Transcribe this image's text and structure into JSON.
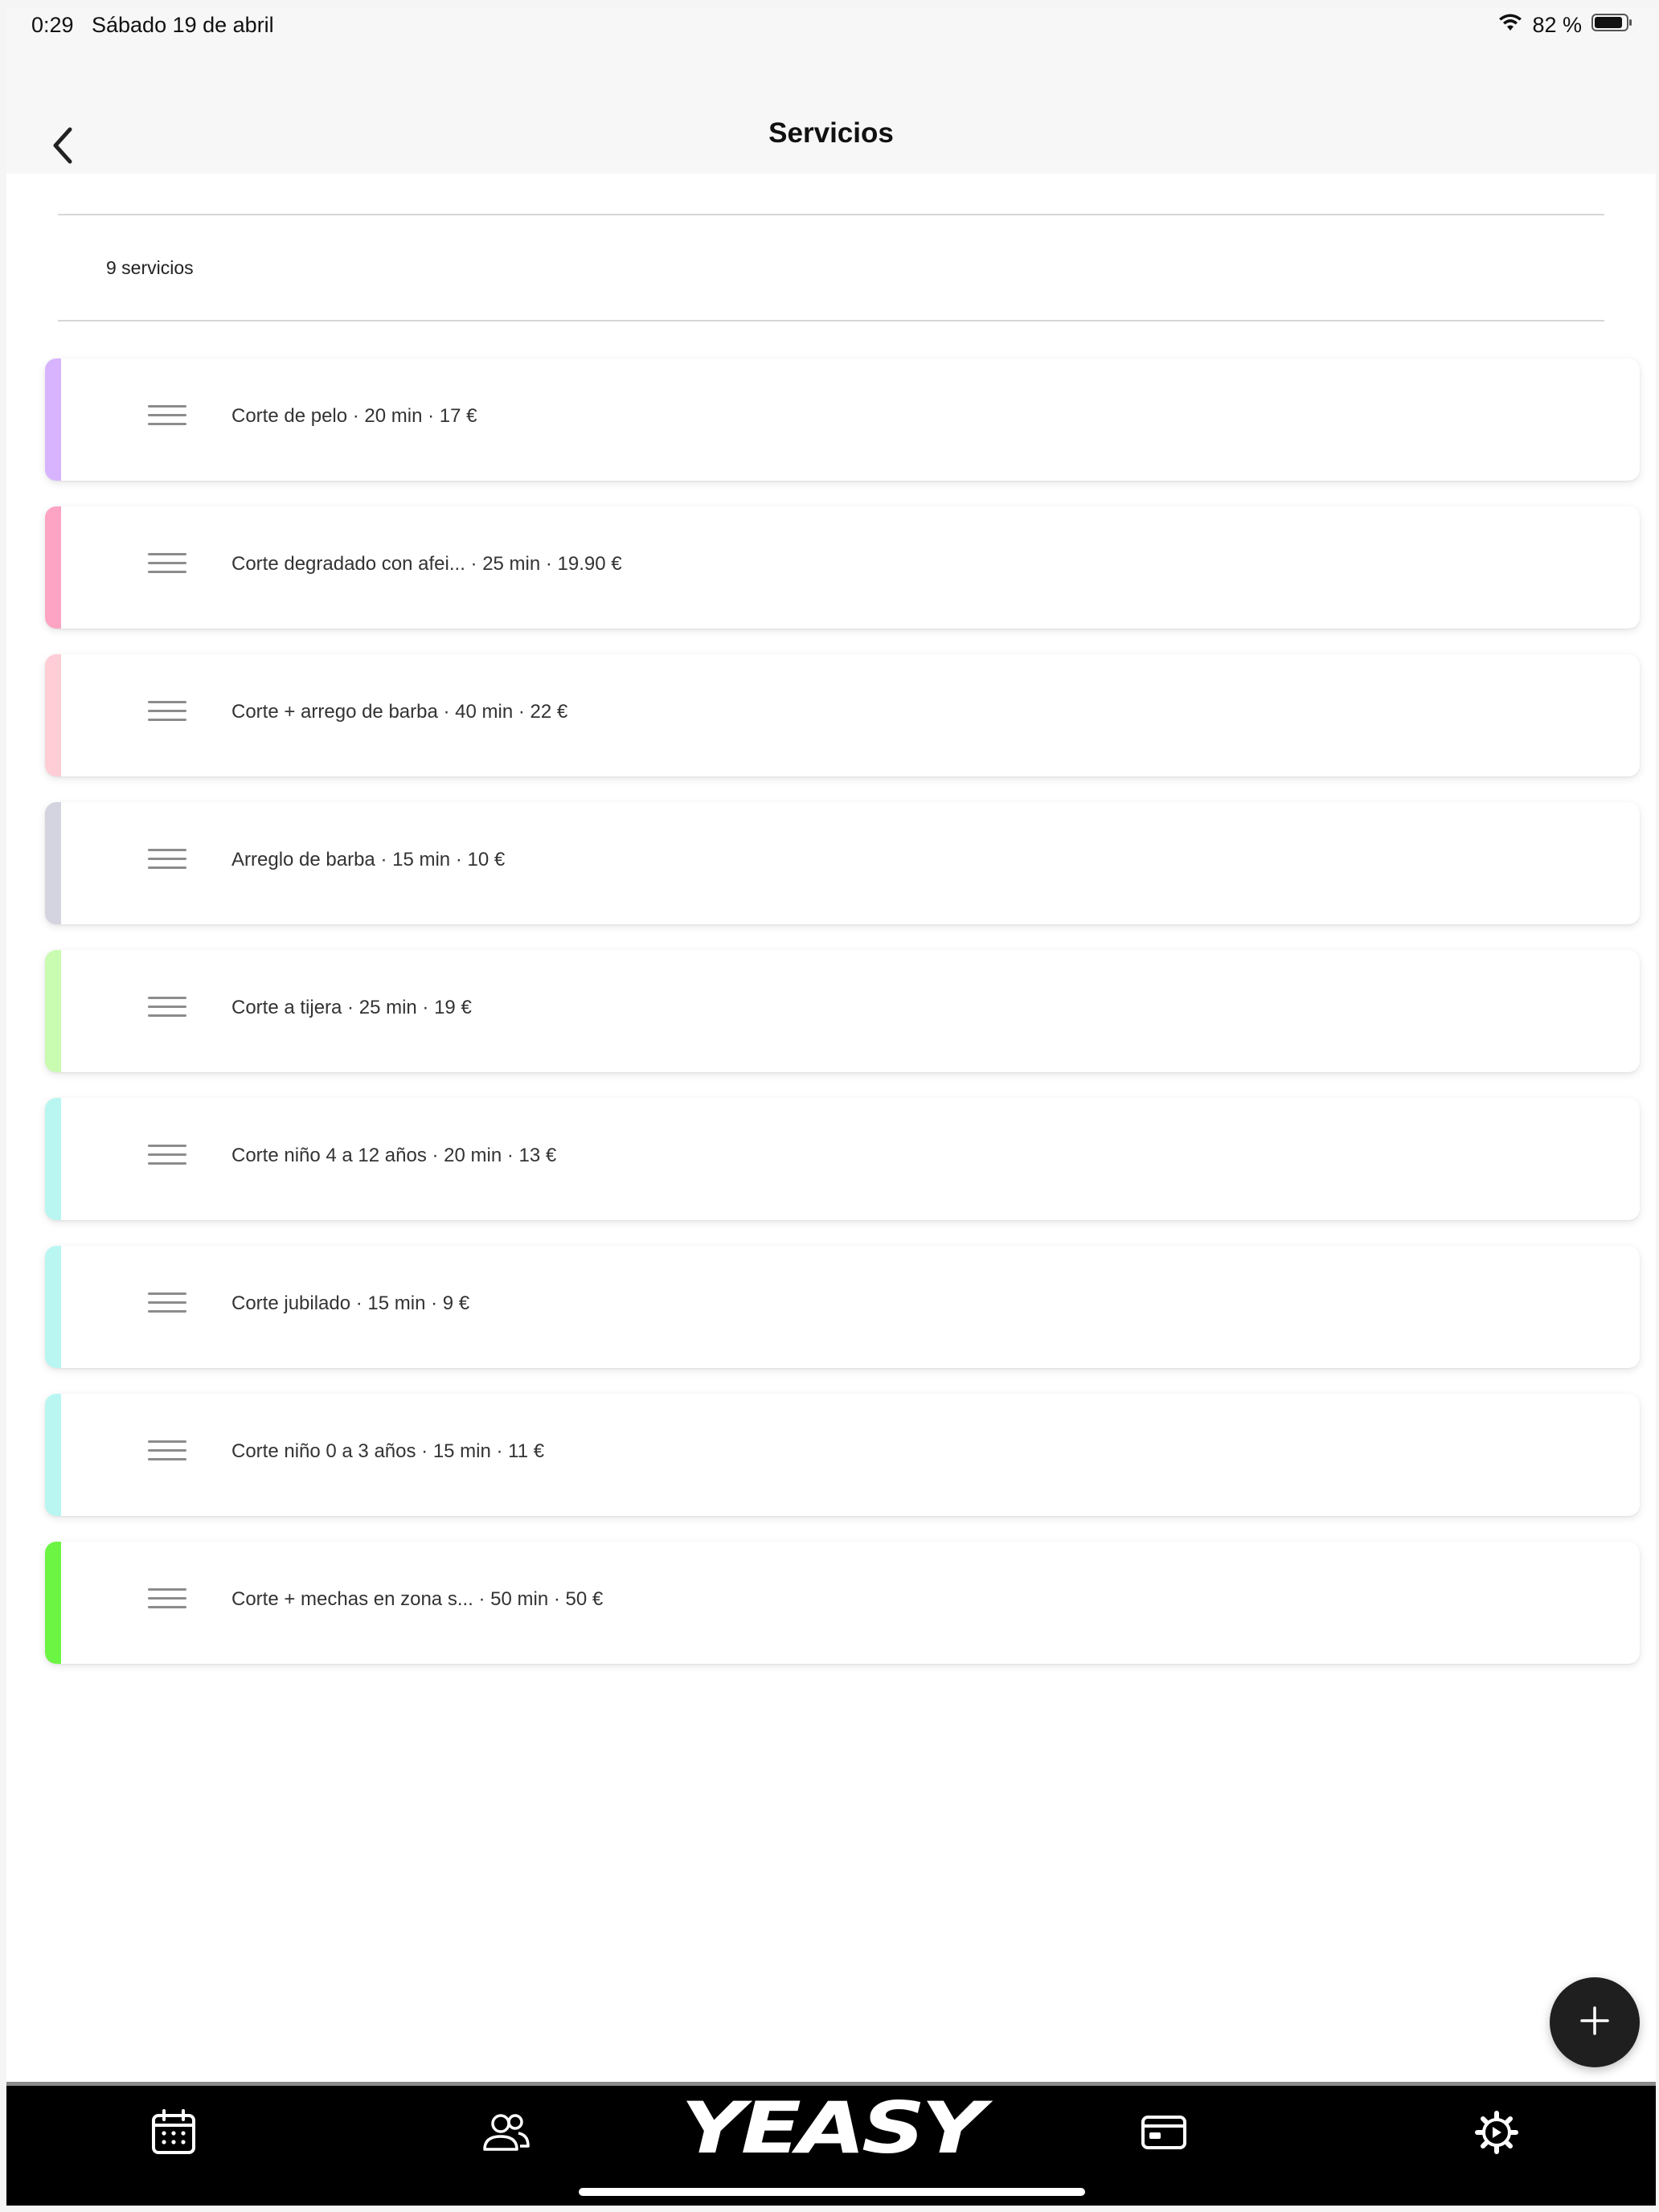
{
  "status_bar": {
    "time": "0:29",
    "date": "Sábado 19 de abril",
    "battery": "82 %"
  },
  "header": {
    "title": "Servicios"
  },
  "count": {
    "label": "9 servicios"
  },
  "services": [
    {
      "label": "Corte de pelo · 20 min · 17 €",
      "color": "#d8b4fe"
    },
    {
      "label": "Corte degradado con afei... · 25 min · 19.90 €",
      "color": "#fda4c4"
    },
    {
      "label": "Corte + arrego de barba · 40 min · 22 €",
      "color": "#fecdd6"
    },
    {
      "label": "Arreglo de barba · 15 min · 10 €",
      "color": "#d4d4e0"
    },
    {
      "label": "Corte a tijera · 25 min · 19 €",
      "color": "#c9fbb0"
    },
    {
      "label": "Corte niño 4 a 12 años · 20 min · 13 €",
      "color": "#b9f6f1"
    },
    {
      "label": "Corte jubilado · 15 min · 9 €",
      "color": "#b9f6f1"
    },
    {
      "label": "Corte niño 0 a 3 años · 15 min · 11 €",
      "color": "#b9f6f1"
    },
    {
      "label": "Corte + mechas en zona s... · 50 min · 50 €",
      "color": "#6cf542"
    }
  ],
  "bottom_nav": {
    "brand": "YEASY",
    "items": [
      "calendar-icon",
      "users-icon",
      "card-icon",
      "settings-icon"
    ]
  }
}
